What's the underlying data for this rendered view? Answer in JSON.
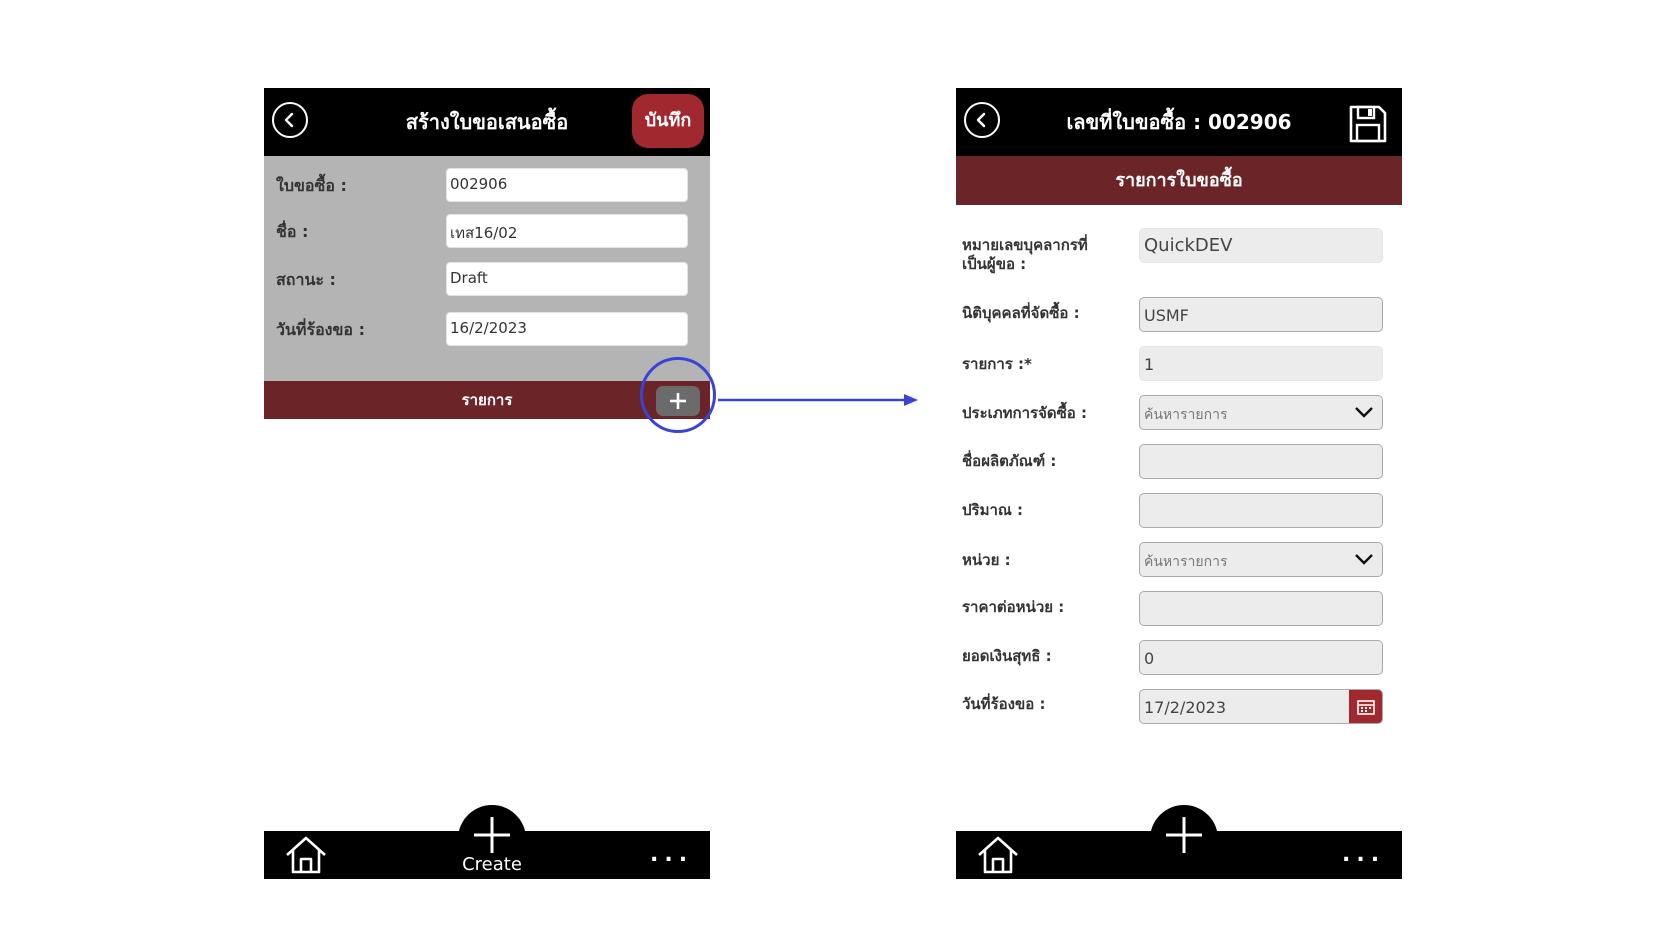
{
  "left": {
    "title": "สร้างใบขอเสนอซื้อ",
    "save_label": "บันทึก",
    "fields": [
      {
        "label": "ใบขอซื้อ :",
        "value": "002906"
      },
      {
        "label": "ชื่อ :",
        "value": "เทส16/02"
      },
      {
        "label": "สถานะ :",
        "value": "Draft"
      },
      {
        "label": "วันที่ร้องขอ :",
        "value": "16/2/2023"
      }
    ],
    "items_bar_label": "รายการ",
    "create_label": "Create",
    "more_label": "..."
  },
  "right": {
    "title": "เลขที่ใบขอซื้อ : 002906",
    "section_title": "รายการใบขอซื้อ",
    "fields": [
      {
        "label_line1": "หมายเลขบุคลากรที่",
        "label_line2": "เป็นผู้ขอ :",
        "value": "QuickDEV"
      },
      {
        "label": "นิติบุคคลที่จัดซื้อ :",
        "value": "USMF"
      },
      {
        "label": "รายการ :*",
        "value": "1"
      },
      {
        "label": "ประเภทการจัดซื้อ :",
        "placeholder": "ค้นหารายการ"
      },
      {
        "label": "ชื่อผลิตภัณฑ์ :",
        "value": ""
      },
      {
        "label": "ปริมาณ :",
        "value": ""
      },
      {
        "label": "หน่วย :",
        "placeholder": "ค้นหารายการ"
      },
      {
        "label": "ราคาต่อหน่วย :",
        "value": ""
      },
      {
        "label": "ยอดเงินสุทธิ :",
        "value": "0"
      },
      {
        "label": "วันที่ร้องขอ :",
        "value": "17/2/2023"
      }
    ],
    "more_label": "..."
  },
  "colors": {
    "bar_black": "#000000",
    "accent_dark_red": "#6b2428",
    "button_red": "#a1282e",
    "form_gray": "#b4b4b4",
    "highlight_blue": "#3a43d6"
  },
  "icons": [
    "back-icon",
    "save-icon",
    "plus-icon",
    "home-icon",
    "more-icon",
    "chevron-down-icon",
    "calendar-icon",
    "arrow-right-icon"
  ]
}
